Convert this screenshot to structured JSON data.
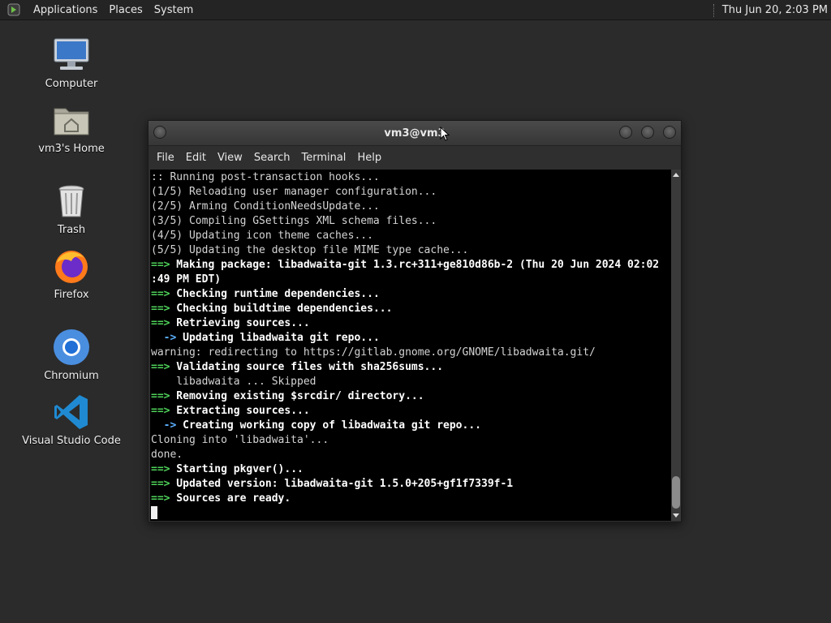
{
  "top_panel": {
    "menus": [
      "Applications",
      "Places",
      "System"
    ],
    "clock": "Thu Jun 20,  2:03 PM"
  },
  "desktop_icons": [
    {
      "label": "Computer",
      "icon": "computer-icon"
    },
    {
      "label": "vm3's Home",
      "icon": "home-folder-icon"
    },
    {
      "label": "Trash",
      "icon": "trash-icon"
    },
    {
      "label": "Firefox",
      "icon": "firefox-icon"
    },
    {
      "label": "Chromium",
      "icon": "chromium-icon"
    },
    {
      "label": "Visual Studio Code",
      "icon": "vscode-icon"
    }
  ],
  "terminal": {
    "title": "vm3@vm3",
    "menu": [
      "File",
      "Edit",
      "View",
      "Search",
      "Terminal",
      "Help"
    ],
    "lines": [
      {
        "prefix": "",
        "text": ":: Running post-transaction hooks...",
        "style": "plain"
      },
      {
        "prefix": "",
        "text": "(1/5) Reloading user manager configuration...",
        "style": "plain"
      },
      {
        "prefix": "",
        "text": "(2/5) Arming ConditionNeedsUpdate...",
        "style": "plain"
      },
      {
        "prefix": "",
        "text": "(3/5) Compiling GSettings XML schema files...",
        "style": "plain"
      },
      {
        "prefix": "",
        "text": "(4/5) Updating icon theme caches...",
        "style": "plain"
      },
      {
        "prefix": "",
        "text": "(5/5) Updating the desktop file MIME type cache...",
        "style": "plain"
      },
      {
        "prefix": "==>",
        "text": " Making package: libadwaita-git 1.3.rc+311+ge810d86b-2 (Thu 20 Jun 2024 02:02",
        "style": "bold"
      },
      {
        "prefix": "",
        "text": ":49 PM EDT)",
        "style": "bold"
      },
      {
        "prefix": "==>",
        "text": " Checking runtime dependencies...",
        "style": "bold"
      },
      {
        "prefix": "==>",
        "text": " Checking buildtime dependencies...",
        "style": "bold"
      },
      {
        "prefix": "==>",
        "text": " Retrieving sources...",
        "style": "bold"
      },
      {
        "prefix": "  ->",
        "text": " Updating libadwaita git repo...",
        "style": "bold"
      },
      {
        "prefix": "",
        "text": "warning: redirecting to https://gitlab.gnome.org/GNOME/libadwaita.git/",
        "style": "plain"
      },
      {
        "prefix": "==>",
        "text": " Validating source files with sha256sums...",
        "style": "bold"
      },
      {
        "prefix": "",
        "text": "    libadwaita ... Skipped",
        "style": "plain"
      },
      {
        "prefix": "==>",
        "text": " Removing existing $srcdir/ directory...",
        "style": "bold"
      },
      {
        "prefix": "==>",
        "text": " Extracting sources...",
        "style": "bold"
      },
      {
        "prefix": "  ->",
        "text": " Creating working copy of libadwaita git repo...",
        "style": "bold"
      },
      {
        "prefix": "",
        "text": "Cloning into 'libadwaita'...",
        "style": "plain"
      },
      {
        "prefix": "",
        "text": "done.",
        "style": "plain"
      },
      {
        "prefix": "==>",
        "text": " Starting pkgver()...",
        "style": "bold"
      },
      {
        "prefix": "==>",
        "text": " Updated version: libadwaita-git 1.5.0+205+gf1f7339f-1",
        "style": "bold"
      },
      {
        "prefix": "==>",
        "text": " Sources are ready.",
        "style": "bold"
      }
    ]
  },
  "colors": {
    "prompt_arrow": "#4fd35a",
    "sub_arrow": "#5bb0ff",
    "terminal_bg": "#000000",
    "desktop_bg": "#2b2b2b"
  }
}
